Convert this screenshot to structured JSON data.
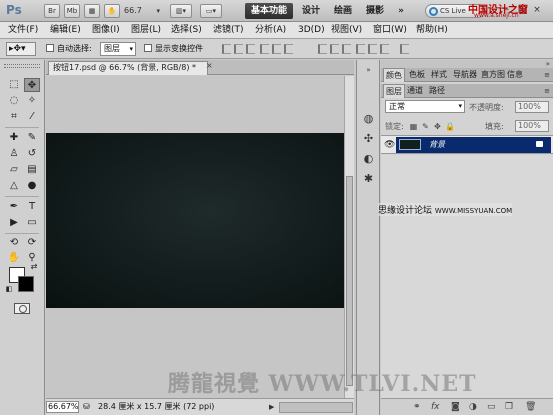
{
  "app": {
    "logo": "Ps",
    "bridge_button": "Br",
    "minibridge_button": "Mb",
    "zoom_level": "66.7",
    "workspaces": [
      "基本功能",
      "设计",
      "绘画",
      "摄影"
    ],
    "more": "»",
    "cs_live": "CS Live",
    "window_controls": [
      "–",
      "□",
      "×"
    ]
  },
  "menu": [
    "文件(F)",
    "编辑(E)",
    "图像(I)",
    "图层(L)",
    "选择(S)",
    "滤镜(T)",
    "分析(A)",
    "3D(D)",
    "视图(V)",
    "窗口(W)",
    "帮助(H)"
  ],
  "options": {
    "auto_select_label": "自动选择:",
    "auto_select_value": "图层",
    "show_transform_label": "显示变换控件"
  },
  "document": {
    "tab_title": "按钮17.psd @ 66.7% (背景, RGB/8) *",
    "close": "×",
    "zoom": "66.67%",
    "info": "28.4 厘米 x 15.7 厘米 (72 ppi)"
  },
  "dock_icons": [
    "palette-icon",
    "histogram-icon",
    "adjust-icon",
    "brush-preset-icon"
  ],
  "panels": {
    "top_tabs": [
      "颜色",
      "色板",
      "样式",
      "导航器",
      "直方图",
      "信息"
    ],
    "layer_tabs": [
      "图层",
      "通道",
      "路径"
    ],
    "blend_mode": "正常",
    "opacity_label": "不透明度:",
    "opacity_value": "100%",
    "lock_label": "锁定:",
    "fill_label": "填充:",
    "fill_value": "100%",
    "layer_name": "背景",
    "footer_icons": [
      "link-icon",
      "fx-icon",
      "mask-icon",
      "adjustment-icon",
      "folder-icon",
      "new-layer-icon",
      "trash-icon"
    ]
  },
  "watermarks": {
    "top": "中国设计之窗",
    "top_sub": "www.a.sheji.cn",
    "middle": "思缘设计论坛",
    "middle_url": "WWW.MISSYUAN.COM",
    "bottom": "腾龍視覺 WWW.TLVI.NET"
  },
  "colors": {
    "foreground": "#ffffff",
    "background": "#000000",
    "selection": "#0a2a6e",
    "canvas": "#121b1b"
  }
}
